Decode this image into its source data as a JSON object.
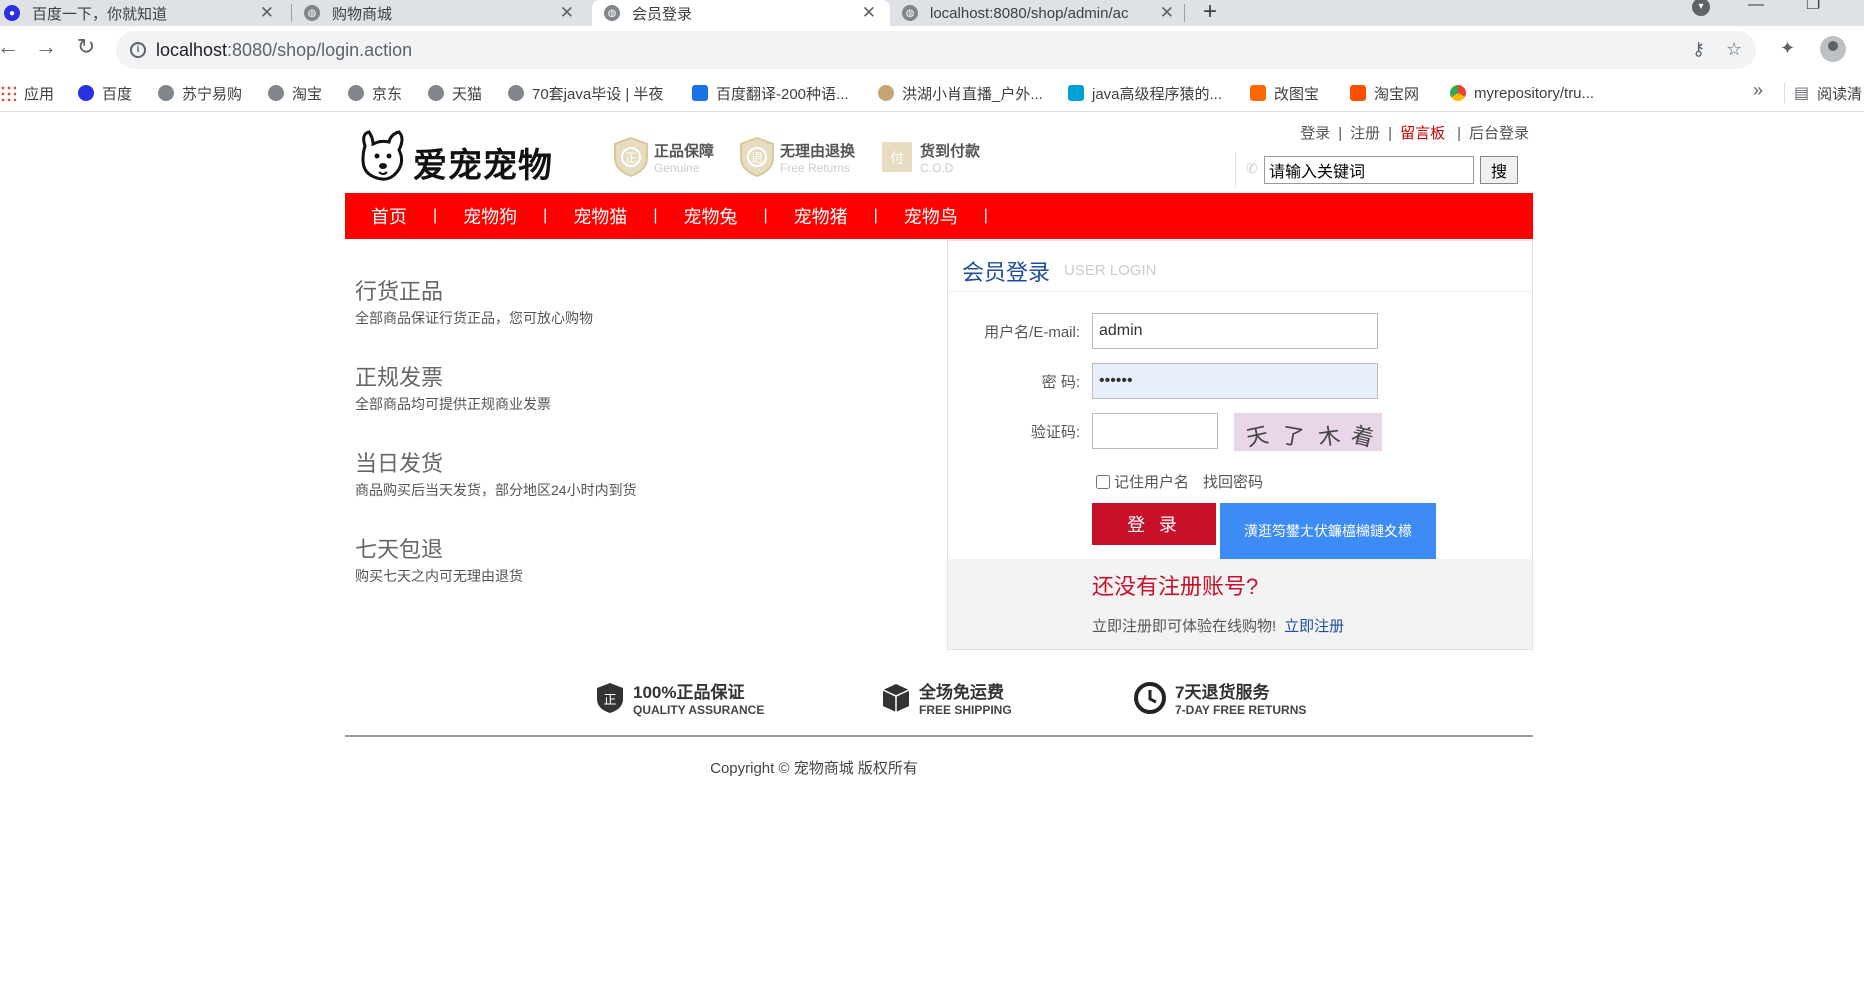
{
  "browser": {
    "tabs": [
      {
        "title": "百度一下，你就知道",
        "active": false
      },
      {
        "title": "购物商城",
        "active": false
      },
      {
        "title": "会员登录",
        "active": true
      },
      {
        "title": "localhost:8080/shop/admin/ac",
        "active": false
      }
    ],
    "new_tab": "+",
    "url_host": "localhost",
    "url_rest": ":8080/shop/login.action",
    "bookmarks": [
      {
        "label": "应用",
        "icon": "apps-grid-icon"
      },
      {
        "label": "百度",
        "icon": "baidu-paw-icon"
      },
      {
        "label": "苏宁易购",
        "icon": "globe-icon"
      },
      {
        "label": "淘宝",
        "icon": "globe-icon"
      },
      {
        "label": "京东",
        "icon": "globe-icon"
      },
      {
        "label": "天猫",
        "icon": "globe-icon"
      },
      {
        "label": "70套java毕设 | 半夜",
        "icon": "globe-icon"
      },
      {
        "label": "百度翻译-200种语...",
        "icon": "translate-icon"
      },
      {
        "label": "洪湖小肖直播_户外...",
        "icon": "bird-icon"
      },
      {
        "label": "java高级程序猿的...",
        "icon": "bilibili-icon"
      },
      {
        "label": "改图宝",
        "icon": "gaitubao-icon"
      },
      {
        "label": "淘宝网",
        "icon": "taobao-icon"
      },
      {
        "label": "myrepository/tru...",
        "icon": "chrome-icon"
      }
    ],
    "more": "»",
    "reading_list": "阅读清"
  },
  "header": {
    "logo_text": "爱宠宠物",
    "badges": [
      {
        "cn": "正品保障",
        "en": "Genuine",
        "glyph": "正"
      },
      {
        "cn": "无理由退换",
        "en": "Free Returns",
        "glyph": "退"
      },
      {
        "cn": "货到付款",
        "en": "C.O.D",
        "glyph": "付"
      }
    ],
    "top_links": {
      "login": "登录",
      "register": "注册",
      "guestbook": "留言板",
      "admin_login": "后台登录",
      "separator": "|"
    },
    "search": {
      "value": "请输入关键词",
      "button": "搜"
    }
  },
  "nav": {
    "items": [
      "首页",
      "宠物狗",
      "宠物猫",
      "宠物兔",
      "宠物猪",
      "宠物鸟"
    ],
    "separator": "|"
  },
  "features": [
    {
      "title": "行货正品",
      "desc": "全部商品保证行货正品，您可放心购物"
    },
    {
      "title": "正规发票",
      "desc": "全部商品均可提供正规商业发票"
    },
    {
      "title": "当日发货",
      "desc": "商品购买后当天发货，部分地区24小时内到货"
    },
    {
      "title": "七天包退",
      "desc": "购买七天之内可无理由退货"
    }
  ],
  "login": {
    "title": "会员登录",
    "title_en": "USER LOGIN",
    "username_label": "用户名/E-mail:",
    "username_value": "admin",
    "password_label": "密  码:",
    "password_value": "••••••",
    "captcha_label": "验证码:",
    "captcha_value": "",
    "captcha_chars": [
      "天",
      "了",
      "木",
      "着"
    ],
    "remember_label": "记住用户名",
    "forgot_label": "找回密码",
    "login_button": "登 录",
    "garbled_button": "潢逛笉鐢ㄤ伏鐮橀檰鏈夊櫒",
    "no_account": "还没有注册账号?",
    "register_hint": "立即注册即可体验在线购物!",
    "register_link": "立即注册"
  },
  "footer": {
    "guarantees": [
      {
        "cn": "100%正品保证",
        "en": "QUALITY ASSURANCE",
        "icon": "shield-icon"
      },
      {
        "cn": "全场免运费",
        "en": "FREE SHIPPING",
        "icon": "box-icon"
      },
      {
        "cn": "7天退货服务",
        "en": "7-DAY FREE RETURNS",
        "icon": "clock-icon"
      }
    ],
    "copyright": "Copyright © 宠物商城 版权所有"
  },
  "colors": {
    "nav_red": "#ff0000",
    "login_red": "#c9102a",
    "blue_button": "#3d8cf5",
    "link_blue": "#1f4e9a"
  }
}
